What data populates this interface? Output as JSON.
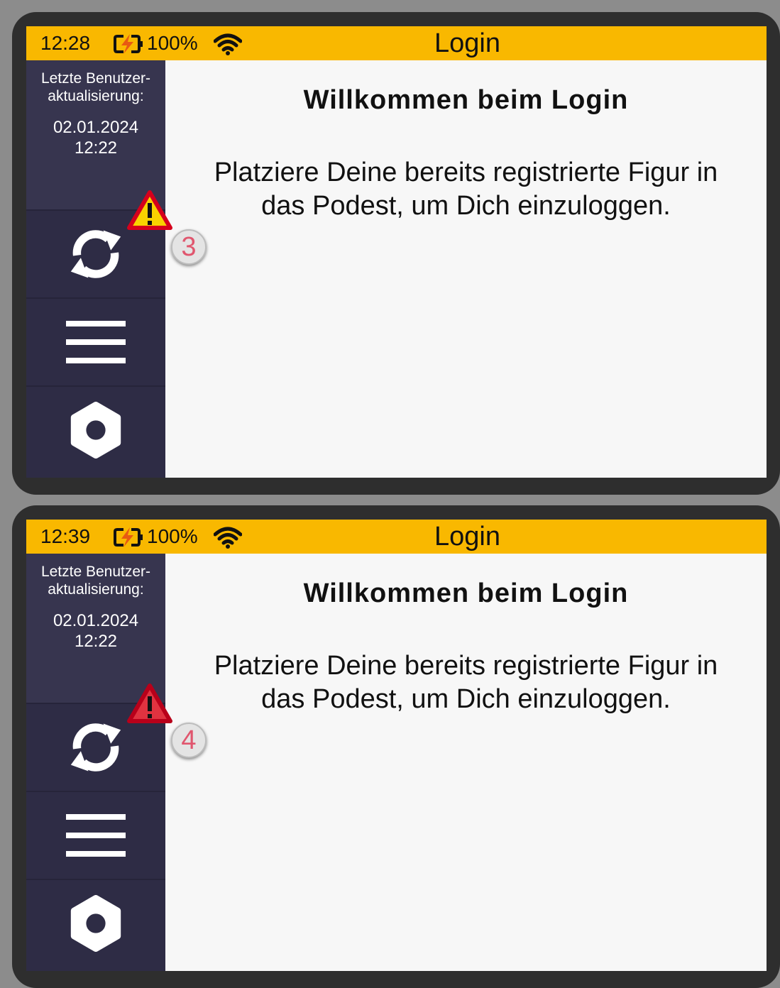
{
  "panels": [
    {
      "status": {
        "time": "12:28",
        "battery": "100%",
        "title": "Login"
      },
      "sidebar": {
        "label": "Letzte Benutzer-\naktualisierung:",
        "date": "02.01.2024\n12:22"
      },
      "content": {
        "welcome": "Willkommen beim Login",
        "instruction": "Platziere Deine bereits registrierte Figur in das Podest, um Dich einzuloggen."
      },
      "annotation": {
        "number": "3",
        "warning_color": "#f9d200"
      }
    },
    {
      "status": {
        "time": "12:39",
        "battery": "100%",
        "title": "Login"
      },
      "sidebar": {
        "label": "Letzte Benutzer-\naktualisierung:",
        "date": "02.01.2024\n12:22"
      },
      "content": {
        "welcome": "Willkommen beim Login",
        "instruction": "Platziere Deine bereits registrierte Figur in das Podest, um Dich einzuloggen."
      },
      "annotation": {
        "number": "4",
        "warning_color": "#e03340"
      }
    }
  ],
  "icons": [
    "battery-charging-icon",
    "wifi-icon",
    "refresh-icon",
    "menu-icon",
    "gear-icon",
    "warning-icon"
  ],
  "colors": {
    "status_bar": "#f9b800",
    "sidebar": "#2e2c45",
    "badge_number": "#e0566e"
  }
}
